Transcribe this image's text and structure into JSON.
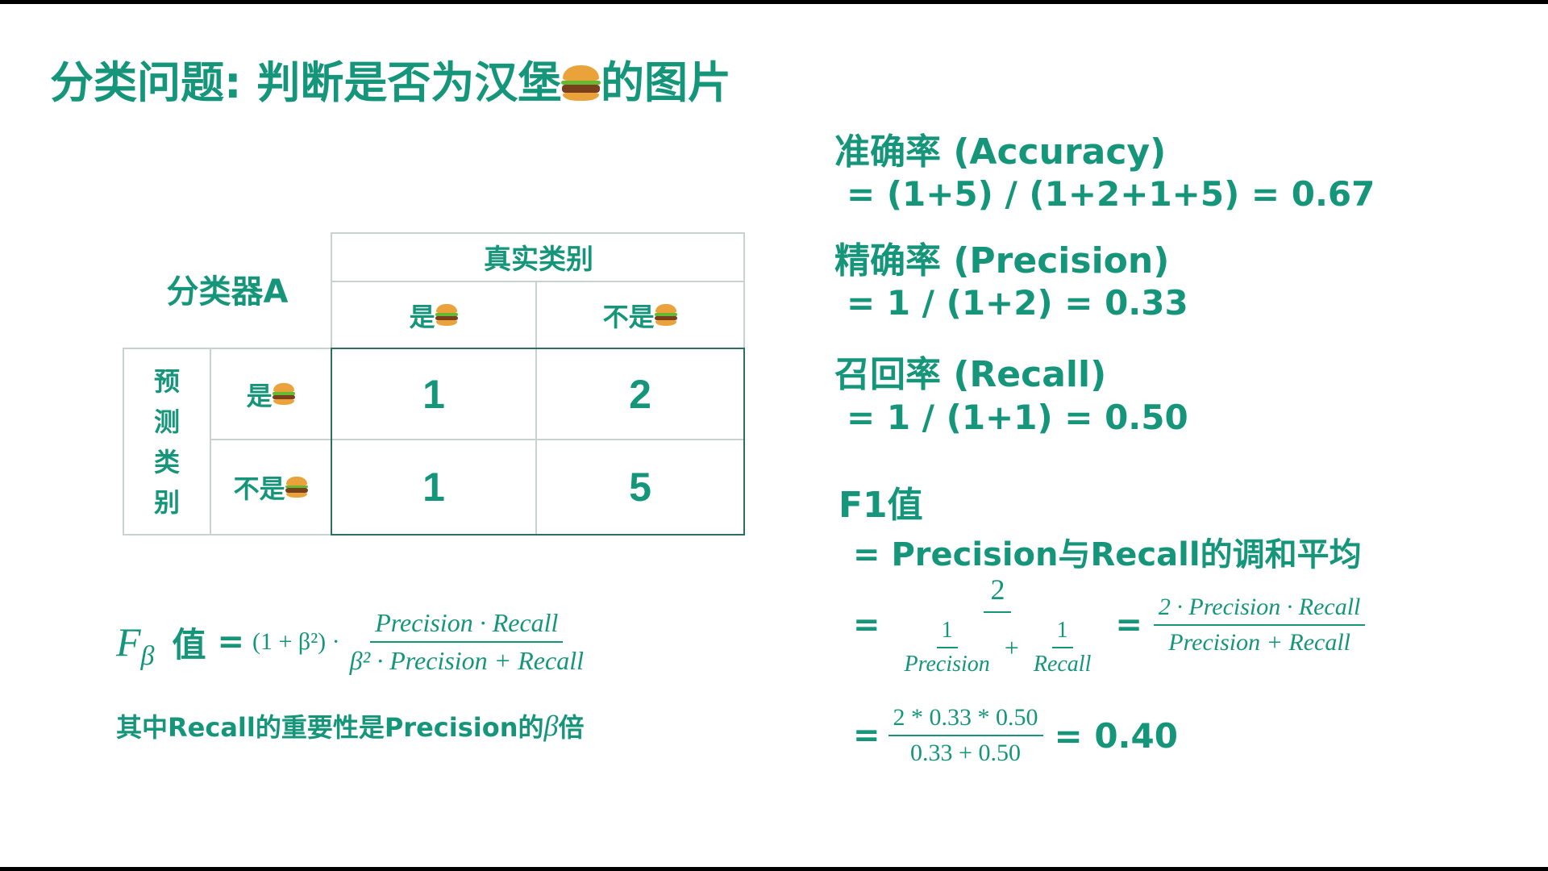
{
  "title": {
    "text": "分类问题: 判断是否为汉堡",
    "suffix": "的图片",
    "icon": "hamburger-emoji"
  },
  "table": {
    "corner_label": "分类器A",
    "true_header": "真实类别",
    "col_headers": [
      "是",
      "不是"
    ],
    "pred_header": [
      "预",
      "测",
      "类",
      "别"
    ],
    "row_headers": [
      "是",
      "不是"
    ],
    "cells": [
      [
        "1",
        "2"
      ],
      [
        "1",
        "5"
      ]
    ]
  },
  "fbeta": {
    "symbol": "F",
    "sub": "β",
    "label": "值",
    "eq": "=",
    "coef": "(1 + β²) ·",
    "numerator": "Precision · Recall",
    "denominator": "β² · Precision + Recall",
    "note_prefix": "其中Recall的重要性是Precision的",
    "note_beta": "β",
    "note_suffix": "倍"
  },
  "metrics": {
    "accuracy_title": "准确率 (Accuracy)",
    "accuracy_eq": "= (1+5) / (1+2+1+5) = 0.67",
    "precision_title": "精确率 (Precision)",
    "precision_eq": "= 1 / (1+2) = 0.33",
    "recall_title": "召回率 (Recall)",
    "recall_eq": "= 1 / (1+1) = 0.50",
    "f1_title": "F1值",
    "f1_desc": "= Precision与Recall的调和平均",
    "f1_eq": "=",
    "f1_num": "2",
    "f1_d1_num": "1",
    "f1_d1_den": "Precision",
    "f1_plus": "+",
    "f1_d2_num": "1",
    "f1_d2_den": "Recall",
    "f1_eq2": "=",
    "f1_alt_num": "2 · Precision · Recall",
    "f1_alt_den": "Precision + Recall",
    "calc_eq": "=",
    "calc_num": "2 * 0.33 * 0.50",
    "calc_den": "0.33 + 0.50",
    "calc_result": "= 0.40"
  },
  "colors": {
    "text": "#15967a",
    "grid": "#c8d3d0",
    "grid_dark": "#2c6e62"
  }
}
